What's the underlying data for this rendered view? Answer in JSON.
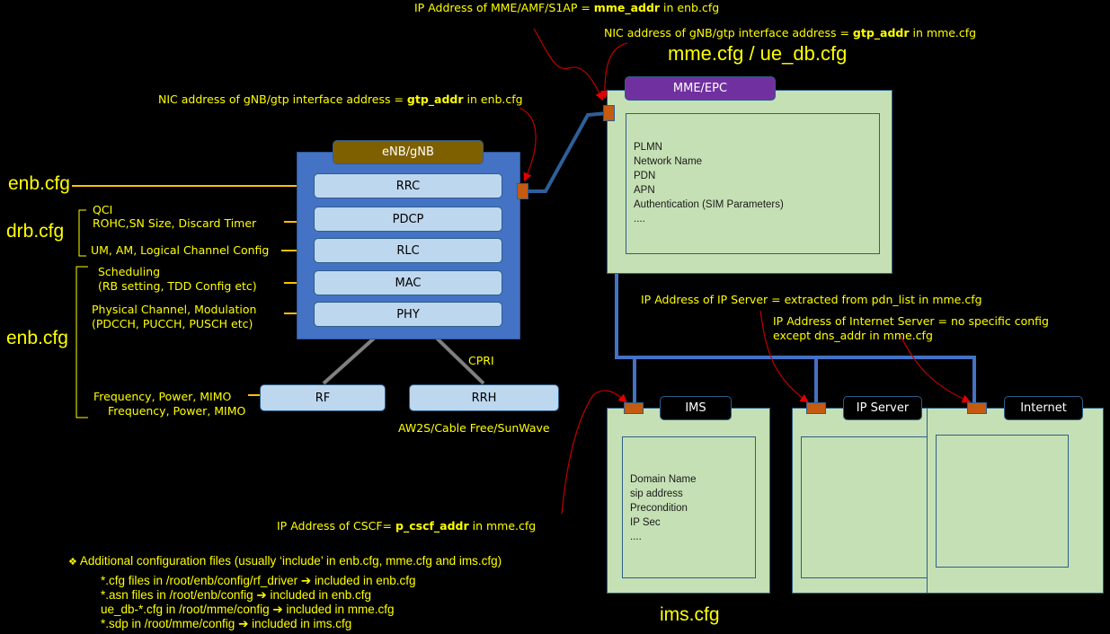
{
  "annotations": {
    "mme_addr": {
      "prefix": "IP Address of MME/AMF/S1AP = ",
      "key": "mme_addr",
      "suffix": " in enb.cfg"
    },
    "gtp_mme": {
      "prefix": "NIC address of gNB/gtp interface address = ",
      "key": "gtp_addr",
      "suffix": " in mme.cfg"
    },
    "gtp_enb": {
      "prefix": "NIC address of gNB/gtp interface address = ",
      "key": "gtp_addr",
      "suffix": " in enb.cfg"
    },
    "ip_server": "IP Address of IP Server = extracted from pdn_list in mme.cfg",
    "internet_line1": "IP Address of Internet Server = no specific config",
    "internet_line2": "except dns_addr in mme.cfg",
    "cscf": {
      "prefix": "IP Address of CSCF= ",
      "key": "p_cscf_addr",
      "suffix": " in mme.cfg"
    },
    "cpri": "CPRI",
    "rrh_vendors": "AW2S/Cable Free/SunWave"
  },
  "config_titles": {
    "mme": "mme.cfg / ue_db.cfg",
    "enb_top": "enb.cfg",
    "drb": "drb.cfg",
    "enb_bottom": "enb.cfg",
    "ims": "ims.cfg"
  },
  "left_labels": {
    "qci": "QCI",
    "rohc": "ROHC,SN Size, Discard Timer",
    "rlc": "UM, AM, Logical Channel Config",
    "sched1": "Scheduling",
    "sched2": "(RB setting, TDD Config etc)",
    "phy1": "Physical Channel, Modulation",
    "phy2": "(PDCCH, PUCCH, PUSCH etc)",
    "rf1": "Frequency, Power, MIMO",
    "rf2": "Frequency, Power, MIMO"
  },
  "enb": {
    "title": "eNB/gNB",
    "layers": [
      "RRC",
      "PDCP",
      "RLC",
      "MAC",
      "PHY"
    ],
    "rf": "RF",
    "rrh": "RRH"
  },
  "mme": {
    "title": "MME/EPC",
    "items": [
      "PLMN",
      "Network Name",
      "PDN",
      "APN",
      "Authentication (SIM Parameters)",
      "...."
    ]
  },
  "servers": {
    "ims": {
      "title": "IMS",
      "items": [
        "Domain Name",
        "sip address",
        "Precondition",
        "IP Sec",
        "...."
      ]
    },
    "ip_server": {
      "title": "IP Server"
    },
    "internet": {
      "title": "Internet"
    }
  },
  "additional": {
    "bullet": "❖",
    "heading": "Additional configuration files (usually ‘include’ in enb.cfg, mme.cfg and ims.cfg)",
    "arrow": "➔",
    "lines": [
      {
        "left": "*.cfg files in /root/enb/config/rf_driver ",
        "right": "included in enb.cfg"
      },
      {
        "left": "*.asn files in /root/enb/config",
        "right": "included in enb.cfg"
      },
      {
        "left": "ue_db-*.cfg in /root/mme/config",
        "right": "included in mme.cfg"
      },
      {
        "left": "*.sdp in /root/mme/config",
        "right": "included in ims.cfg"
      }
    ]
  },
  "colors": {
    "annotation": "#ffff00",
    "enb_body": "#4472c4",
    "enb_tag": "#7f6000",
    "mme_tag": "#7030a0",
    "node_fill": "#c5e0b4",
    "layer_fill": "#bdd7ee",
    "port": "#c55a11",
    "link": "#2e5f9a",
    "arrow": "#e00000"
  }
}
